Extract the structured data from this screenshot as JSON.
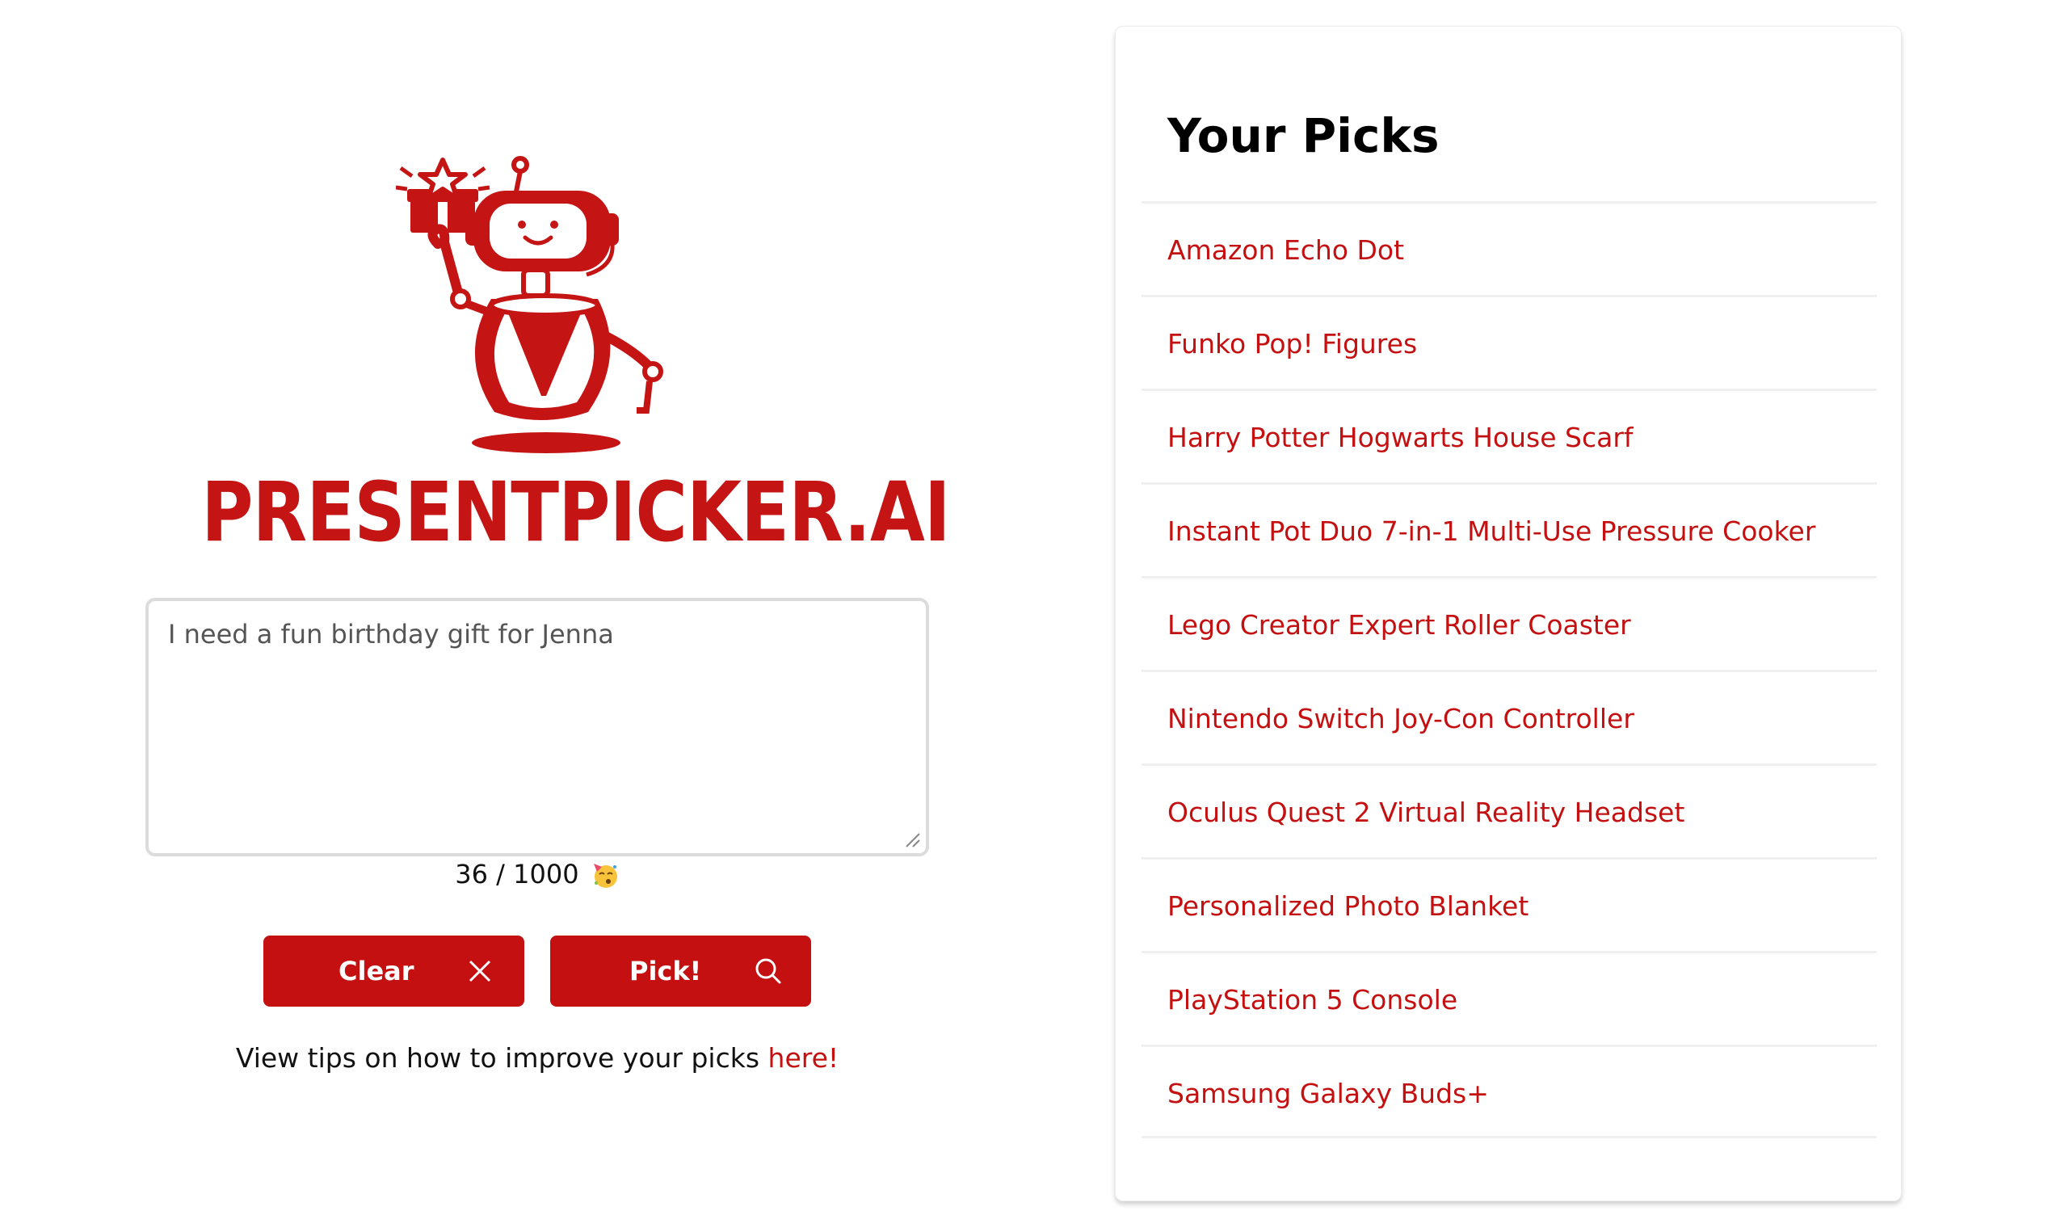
{
  "brand": {
    "name": "PRESENTPICKER.AI",
    "accent": "#c41010"
  },
  "prompt": {
    "value": "I need a fun birthday gift for Jenna"
  },
  "counter": {
    "text": "36 / 1000",
    "emoji": "face-with-party-horn"
  },
  "buttons": {
    "clear_label": "Clear",
    "pick_label": "Pick!"
  },
  "tips": {
    "text": "View tips on how to improve your picks ",
    "link": "here!"
  },
  "picks": {
    "title": "Your Picks",
    "items": [
      "Amazon Echo Dot",
      "Funko Pop! Figures",
      "Harry Potter Hogwarts House Scarf",
      "Instant Pot Duo 7-in-1 Multi-Use Pressure Cooker",
      "Lego Creator Expert Roller Coaster",
      "Nintendo Switch Joy-Con Controller",
      "Oculus Quest 2 Virtual Reality Headset",
      "Personalized Photo Blanket",
      "PlayStation 5 Console",
      "Samsung Galaxy Buds+"
    ]
  }
}
